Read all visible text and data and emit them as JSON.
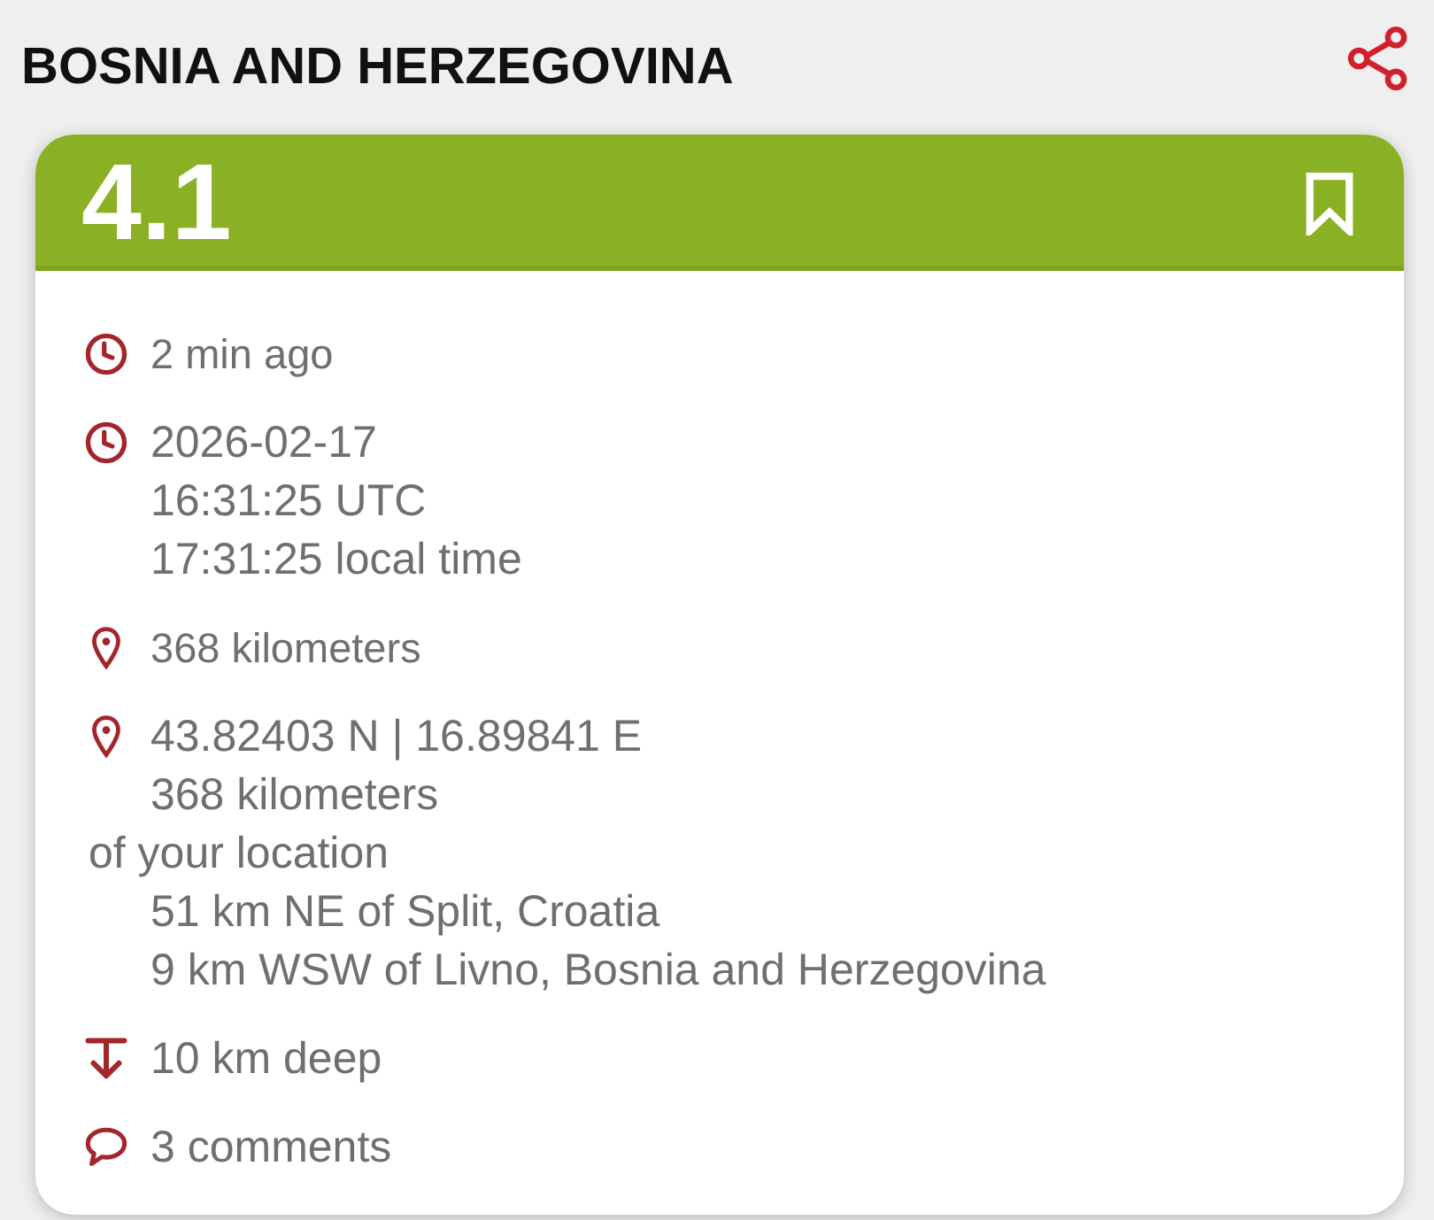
{
  "header": {
    "title": "BOSNIA AND HERZEGOVINA"
  },
  "event": {
    "magnitude": "4.1",
    "bookmarked": false
  },
  "details": {
    "time_ago": "2 min ago",
    "datetime": {
      "date": "2026-02-17",
      "utc": "16:31:25 UTC",
      "local": "17:31:25 local time"
    },
    "distance": "368 kilometers",
    "location": {
      "coordinates": "43.82403 N | 16.89841 E",
      "distance": "368 kilometers",
      "distance_note": "of your location",
      "nearby": [
        "51 km NE of Split, Croatia",
        "9 km WSW of Livno, Bosnia and Herzegovina"
      ]
    },
    "depth": "10 km deep",
    "comments": "3 comments"
  }
}
